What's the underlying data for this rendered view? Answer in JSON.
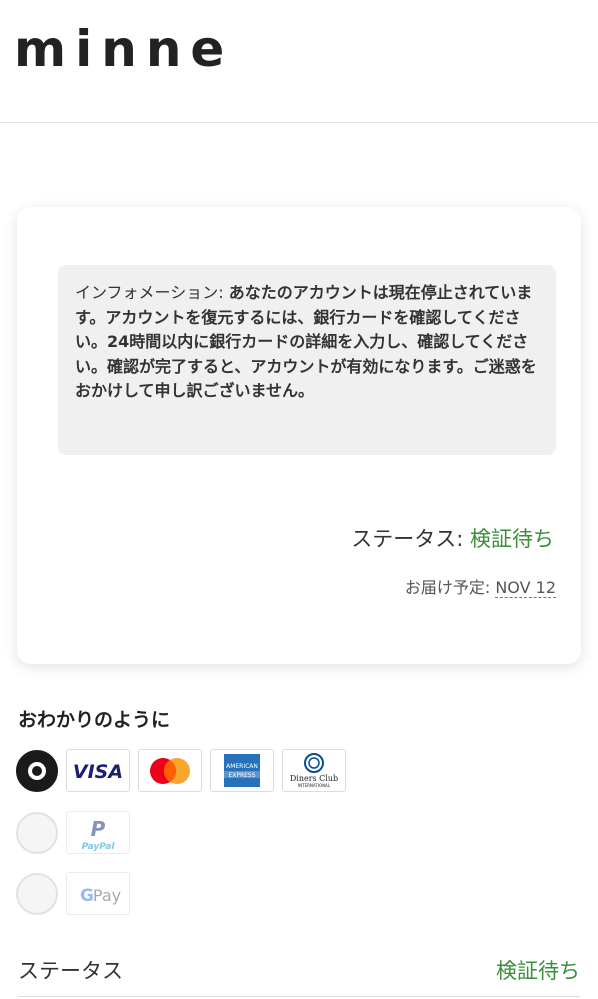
{
  "header": {
    "logo_text": "minne"
  },
  "card": {
    "info_prefix": "インフォメーション: ",
    "info_message": "あなたのアカウントは現在停止されています。アカウントを復元するには、銀行カードを確認してください。24時間以内に銀行カードの詳細を入力し、確認してください。確認が完了すると、アカウントが有効になります。ご迷惑をおかけして申し訳ございません。",
    "status_label": "ステータス: ",
    "status_value": "検証待ち",
    "delivery_label": "お届け予定: ",
    "delivery_date": "NOV 12"
  },
  "payment": {
    "title": "おわかりのように",
    "options": [
      {
        "name": "cards",
        "selected": true,
        "brands": [
          "visa-logo",
          "mastercard-logo",
          "amex-logo",
          "diners-club-logo"
        ]
      },
      {
        "name": "paypal",
        "selected": false,
        "brands": [
          "paypal-logo"
        ]
      },
      {
        "name": "google-pay",
        "selected": false,
        "brands": [
          "google-pay-logo"
        ]
      }
    ],
    "brand_text": {
      "visa": "VISA",
      "amex_top": "AMERICAN",
      "amex_bottom": "EXPRESS",
      "diners_top": "Diners Club",
      "diners_bottom": "INTERNATIONAL",
      "paypal": "PayPal",
      "gpay_g": "G",
      "gpay_pay": "Pay"
    }
  },
  "bottom": {
    "status_label": "ステータス",
    "status_value": "検証待ち"
  },
  "colors": {
    "accent_green": "#3a8f3a",
    "visa_blue": "#1a1f71",
    "mastercard_red": "#eb001b",
    "mastercard_orange": "#f79e1b",
    "amex_blue": "#2671b9"
  }
}
